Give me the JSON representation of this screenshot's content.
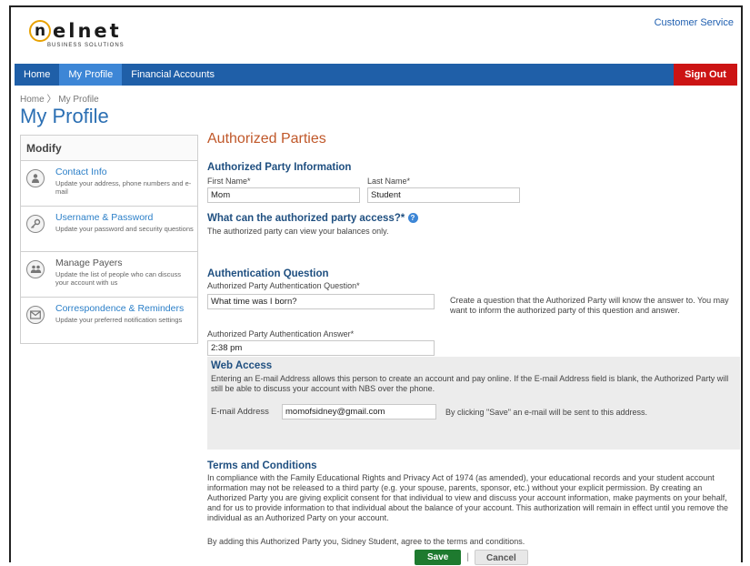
{
  "header": {
    "logo_text": "elnet",
    "logo_n": "n",
    "logo_subtitle": "BUSINESS SOLUTIONS",
    "customer_service": "Customer Service"
  },
  "nav": {
    "home": "Home",
    "my_profile": "My Profile",
    "financial_accounts": "Financial Accounts",
    "sign_out": "Sign Out"
  },
  "breadcrumb": {
    "home": "Home",
    "sep": "〉",
    "current": "My Profile"
  },
  "page_title": "My Profile",
  "sidebar": {
    "heading": "Modify",
    "items": [
      {
        "title": "Contact Info",
        "desc": "Update your address, phone numbers and e-mail",
        "icon": "person-icon"
      },
      {
        "title": "Username & Password",
        "desc": "Update your password and security questions",
        "icon": "key-icon"
      },
      {
        "title": "Manage Payers",
        "desc": "Update the list of people who can discuss your account with us",
        "icon": "people-icon"
      },
      {
        "title": "Correspondence & Reminders",
        "desc": "Update your preferred notification settings",
        "icon": "envelope-icon"
      }
    ]
  },
  "main": {
    "heading": "Authorized Parties",
    "party_info": {
      "title": "Authorized Party Information",
      "first_name_label": "First Name*",
      "first_name_value": "Mom",
      "last_name_label": "Last Name*",
      "last_name_value": "Student"
    },
    "access": {
      "title": "What can the authorized party access?*",
      "help": "?",
      "desc": "The authorized party can view your balances only."
    },
    "auth": {
      "title": "Authentication Question",
      "question_label": "Authorized Party Authentication Question*",
      "question_value": "What time was I born?",
      "question_hint": "Create a question that the Authorized Party will know the answer to. You may want to inform the authorized party of this question and answer.",
      "answer_label": "Authorized Party Authentication Answer*",
      "answer_value": "2:38 pm"
    },
    "web": {
      "title": "Web Access",
      "desc": "Entering an E-mail Address allows this person to create an account and pay online. If the E-mail Address field is blank, the Authorized Party will still be able to discuss your account with NBS over the phone.",
      "email_label": "E-mail Address",
      "email_value": "momofsidney@gmail.com",
      "email_hint": "By clicking \"Save\" an e-mail will be sent to this address."
    },
    "terms": {
      "title": "Terms and Conditions",
      "body": "In compliance with the Family Educational Rights and Privacy Act of 1974 (as amended), your educational records and your student account information may not be released to a third party (e.g. your spouse, parents, sponsor, etc.) without your explicit permission. By creating an Authorized Party you are giving explicit consent for that individual to view and discuss your account information, make payments on your behalf, and for us to provide information to that individual about the balance of your account. This authorization will remain in effect until you remove the individual as an Authorized Party on your account.",
      "agree": "By adding this Authorized Party you, Sidney Student, agree to the terms and conditions."
    },
    "buttons": {
      "save": "Save",
      "sep": "|",
      "cancel": "Cancel"
    }
  },
  "colors": {
    "nav": "#1f5fa8",
    "nav_active": "#3d86d6",
    "sign_out": "#cc1414",
    "heading_orange": "#c0582a",
    "section_blue": "#1f4f80",
    "save_green": "#1e7a2f"
  }
}
